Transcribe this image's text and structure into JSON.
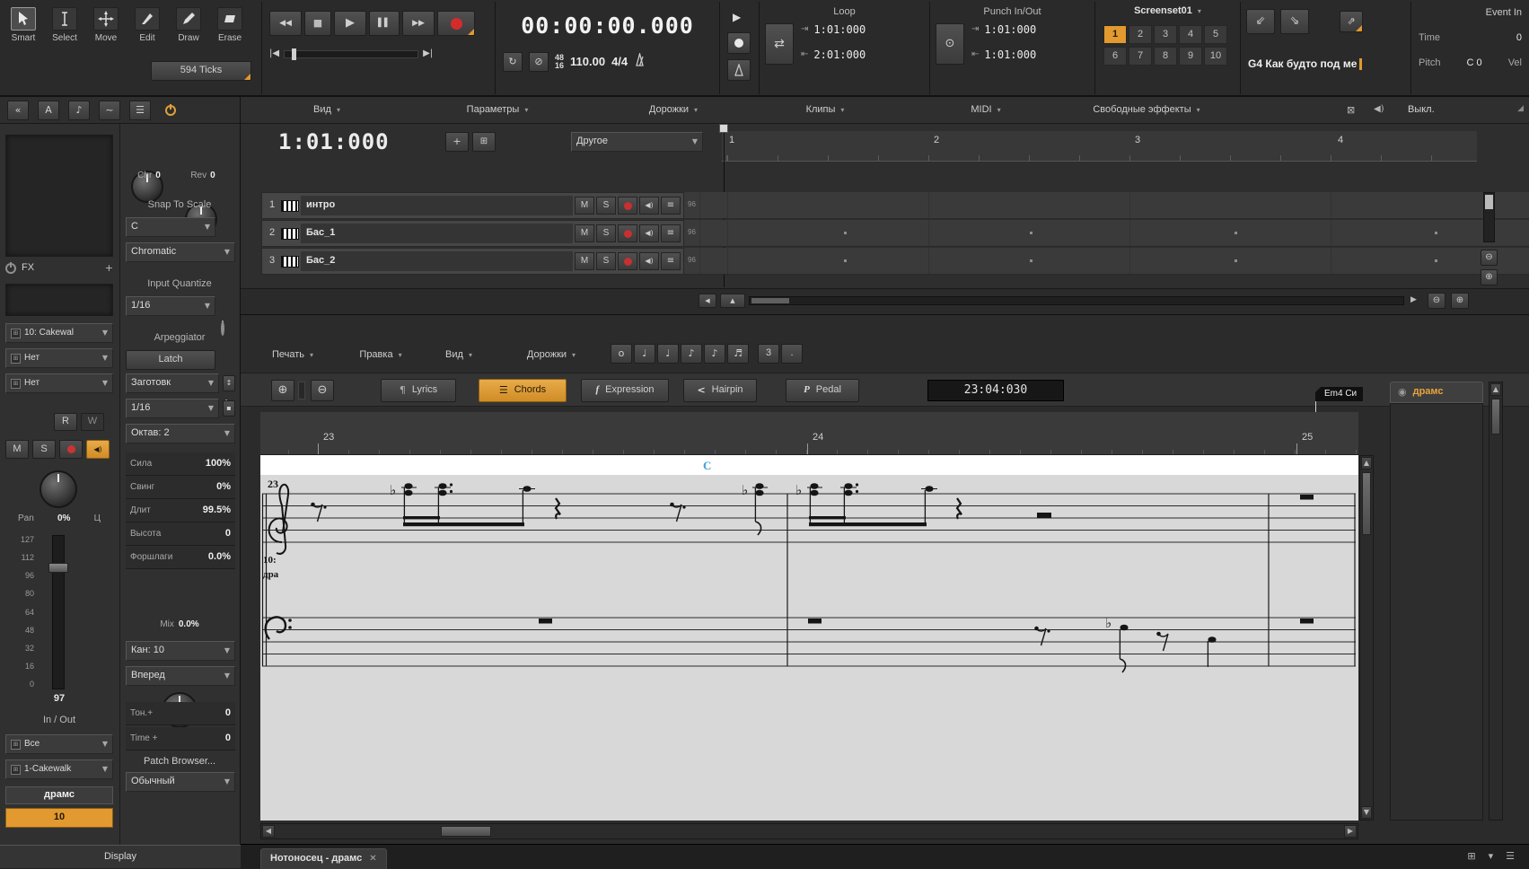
{
  "icons": {
    "rewind": "◀◀",
    "stop": "■",
    "play": "▶",
    "pause": "▌▌",
    "forward": "▶▶",
    "record": "●",
    "to_start": "|◀",
    "to_end": "▶|",
    "caret": "▼",
    "caret_sm": "▾",
    "plus": "+",
    "minus": "−",
    "close": "✕",
    "collapse": "«",
    "letter_a": "A",
    "note": "♪",
    "wave": "~",
    "list": "☰",
    "sync": "↻",
    "slash": "⊘",
    "loop_toggle": "⇄",
    "punch_toggle": "⊙",
    "in_mark": "⇥",
    "out_mark": "⇤",
    "marker_prev": "⇙",
    "marker_next": "⇘",
    "marker_add": "⇗",
    "zoom_in": "⊕",
    "zoom_out": "⊖",
    "left": "◀",
    "right": "▶",
    "up": "▲",
    "down": "▼",
    "grid": "⊞",
    "filter": "⊠",
    "monitor": "◀)",
    "chevron": "≡",
    "corner": "◢",
    "lyrics": "¶",
    "chords": "☰",
    "expression": "f",
    "hairpin": "<",
    "pedal": "P",
    "lock": "▪",
    "spin": "↕",
    "drum": "◉",
    "thumb": "▪"
  },
  "toolbar": {
    "tools": [
      "Smart",
      "Select",
      "Move",
      "Edit",
      "Draw",
      "Erase"
    ],
    "ticks": "594 Ticks",
    "time": "00:00:00.000",
    "meter_top": "48",
    "meter_bottom": "16",
    "tempo": "110.00",
    "timesig": "4/4",
    "loop_title": "Loop",
    "loop_from": "1:01:000",
    "loop_to": "2:01:000",
    "punch_title": "Punch In/Out",
    "punch_in": "1:01:000",
    "punch_out": "1:01:000",
    "screenset_title": "Screenset01",
    "screenset": [
      "1",
      "2",
      "3",
      "4",
      "5",
      "6",
      "7",
      "8",
      "9",
      "10"
    ],
    "marker": "G4 Как будто под ме",
    "event_title": "Event In",
    "event_rows": {
      "time_label": "Time",
      "time_value": "0",
      "pitch_label": "Pitch",
      "pitch_value": "C 0",
      "vel_label": "Vel"
    }
  },
  "menubar": {
    "items": [
      "Вид",
      "Параметры",
      "Дорожки",
      "Клипы",
      "MIDI",
      "Свободные эффекты"
    ],
    "off": "Выкл."
  },
  "trackpane": {
    "now": "1:01:000",
    "filter": "Другое",
    "ruler": [
      "1",
      "2",
      "3",
      "4"
    ],
    "tracks": [
      {
        "num": "1",
        "name": "интро",
        "m": "M",
        "s": "S",
        "vel": "96"
      },
      {
        "num": "2",
        "name": "Бас_1",
        "m": "M",
        "s": "S",
        "vel": "96"
      },
      {
        "num": "3",
        "name": "Бас_2",
        "m": "M",
        "s": "S",
        "vel": "96"
      }
    ]
  },
  "inspector": {
    "chr": "Chr",
    "chr_v": "0",
    "rev": "Rev",
    "rev_v": "0",
    "snap_title": "Snap To Scale",
    "key": "C",
    "scale": "Chromatic",
    "fx": "FX",
    "iq_title": "Input Quantize",
    "iq": "1/16",
    "input": "10: Cakewal",
    "out1": "Нет",
    "out2": "Нет",
    "arp_title": "Arpeggiator",
    "latch": "Latch",
    "preset": "Заготовк",
    "rate": "1/16",
    "octave": "Октав: 2",
    "r": "R",
    "w": "W",
    "m": "M",
    "s": "S",
    "pan": "Pan",
    "pan_v": "0%",
    "pan_c": "Ц",
    "fader": [
      "127",
      "112",
      "96",
      "80",
      "64",
      "48",
      "32",
      "16",
      "0"
    ],
    "vol": "97",
    "inout": "In / Out",
    "in_all": "Все",
    "out_port": "1-Cakewalk",
    "track": "драмс",
    "track_num": "10",
    "params": [
      {
        "label": "Сила",
        "value": "100%"
      },
      {
        "label": "Свинг",
        "value": "0%"
      },
      {
        "label": "Длит",
        "value": "99.5%"
      },
      {
        "label": "Высота",
        "value": "0"
      },
      {
        "label": "Форшлаги",
        "value": "0.0%"
      }
    ],
    "mix": "Mix",
    "mix_v": "0.0%",
    "chan": "Кан: 10",
    "fwd": "Вперед",
    "ton": "Тон.+",
    "ton_v": "0",
    "timeplus": "Time +",
    "timeplus_v": "0",
    "patch": "Patch Browser...",
    "bank": "Обычный"
  },
  "staff": {
    "menus": [
      "Печать",
      "Правка",
      "Вид",
      "Дорожки"
    ],
    "durations": [
      "o",
      "♩",
      "♩",
      "♪",
      "♪",
      "♬"
    ],
    "triplet": "3",
    "dot": ".",
    "lyrics": "Lyrics",
    "chords": "Chords",
    "expression": "Expression",
    "hairpin": "Hairpin",
    "pedal": "Pedal",
    "position": "23:04:030",
    "ruler": [
      "23",
      "24",
      "25"
    ],
    "flag": "Em4 Си",
    "side_tab": "драмс",
    "chord": "C",
    "measure": "23",
    "label1": "10:",
    "label2": "дра"
  },
  "window": {
    "tab": "Нотоносец - драмс",
    "display": "Display"
  }
}
